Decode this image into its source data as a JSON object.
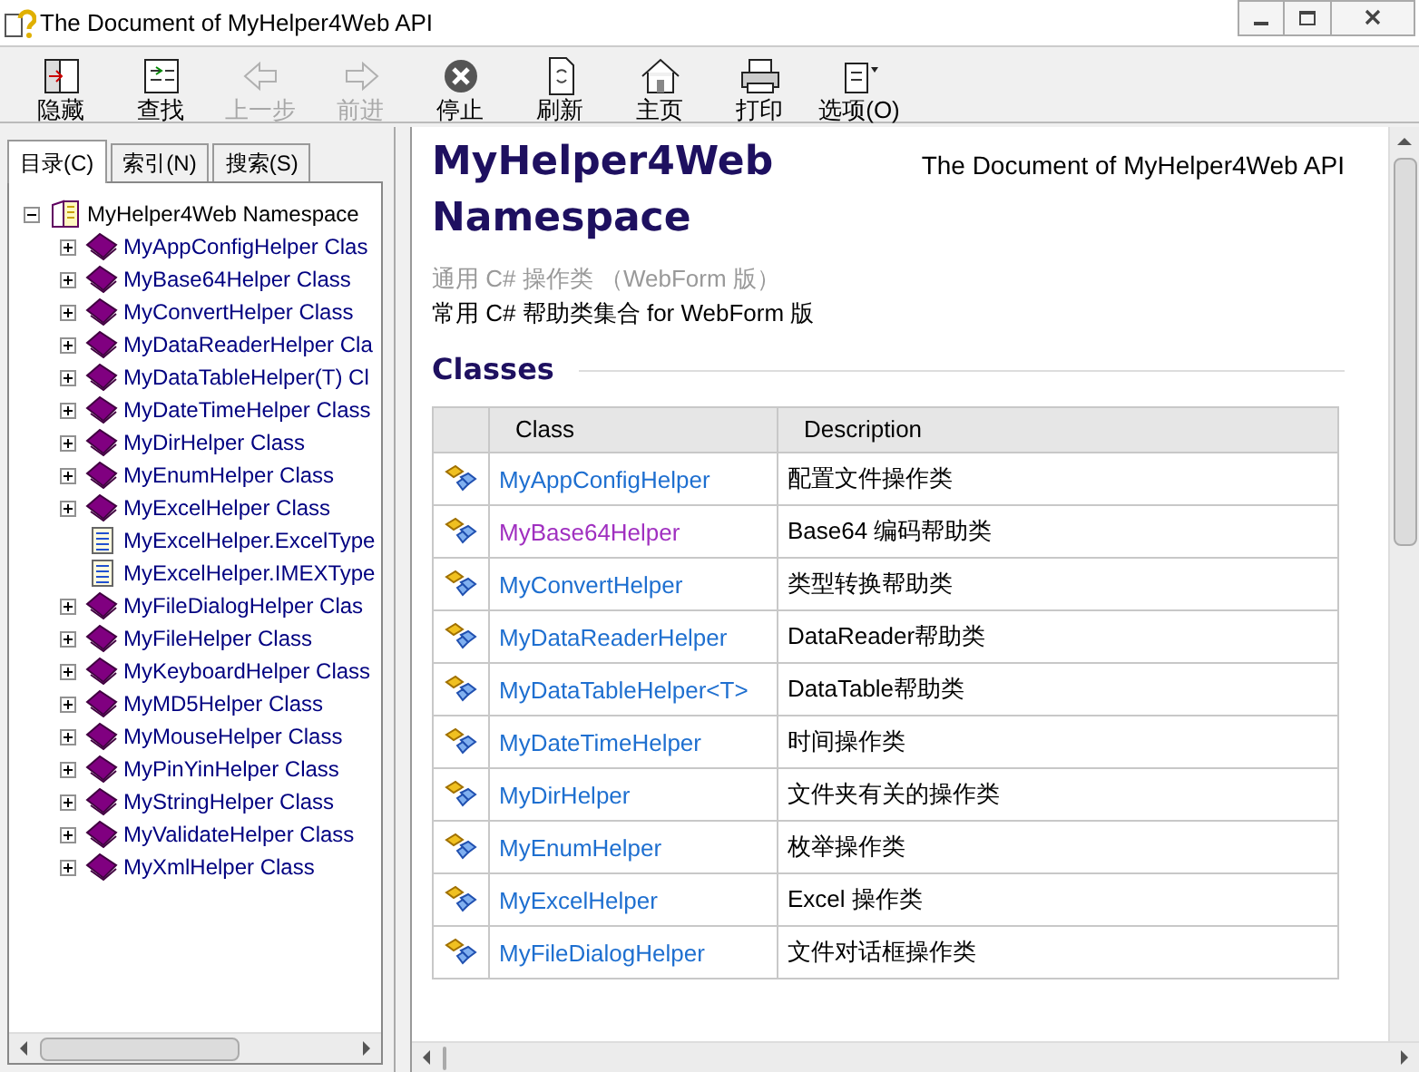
{
  "window": {
    "title": "The Document of MyHelper4Web API"
  },
  "toolbar": [
    {
      "label": "隐藏",
      "kind": "hide",
      "disabled": false
    },
    {
      "label": "查找",
      "kind": "locate",
      "disabled": false
    },
    {
      "label": "上一步",
      "kind": "back",
      "disabled": true
    },
    {
      "label": "前进",
      "kind": "forward",
      "disabled": true
    },
    {
      "label": "停止",
      "kind": "stop",
      "disabled": false
    },
    {
      "label": "刷新",
      "kind": "refresh",
      "disabled": false
    },
    {
      "label": "主页",
      "kind": "home",
      "disabled": false
    },
    {
      "label": "打印",
      "kind": "print",
      "disabled": false
    },
    {
      "label": "选项(O)",
      "kind": "options",
      "disabled": false
    }
  ],
  "tabs": [
    {
      "label": "目录(C)",
      "selected": true
    },
    {
      "label": "索引(N)",
      "selected": false
    },
    {
      "label": "搜索(S)",
      "selected": false
    }
  ],
  "tree": [
    {
      "label": "MyHelper4Web Namespace",
      "kind": "namespace",
      "expanded": true,
      "children": [
        {
          "label": "MyAppConfigHelper Clas",
          "kind": "class",
          "expanded": false
        },
        {
          "label": "MyBase64Helper Class",
          "kind": "class",
          "expanded": false
        },
        {
          "label": "MyConvertHelper Class",
          "kind": "class",
          "expanded": false
        },
        {
          "label": "MyDataReaderHelper Cla",
          "kind": "class",
          "expanded": false
        },
        {
          "label": "MyDataTableHelper(T) Cl",
          "kind": "class",
          "expanded": false
        },
        {
          "label": "MyDateTimeHelper Class",
          "kind": "class",
          "expanded": false
        },
        {
          "label": "MyDirHelper Class",
          "kind": "class",
          "expanded": false
        },
        {
          "label": "MyEnumHelper Class",
          "kind": "class",
          "expanded": false
        },
        {
          "label": "MyExcelHelper Class",
          "kind": "class",
          "expanded": false
        },
        {
          "label": "MyExcelHelper.ExcelType",
          "kind": "page"
        },
        {
          "label": "MyExcelHelper.IMEXType",
          "kind": "page"
        },
        {
          "label": "MyFileDialogHelper Clas",
          "kind": "class",
          "expanded": false
        },
        {
          "label": "MyFileHelper Class",
          "kind": "class",
          "expanded": false
        },
        {
          "label": "MyKeyboardHelper Class",
          "kind": "class",
          "expanded": false
        },
        {
          "label": "MyMD5Helper Class",
          "kind": "class",
          "expanded": false
        },
        {
          "label": "MyMouseHelper Class",
          "kind": "class",
          "expanded": false
        },
        {
          "label": "MyPinYinHelper Class",
          "kind": "class",
          "expanded": false
        },
        {
          "label": "MyStringHelper Class",
          "kind": "class",
          "expanded": false
        },
        {
          "label": "MyValidateHelper Class",
          "kind": "class",
          "expanded": false
        },
        {
          "label": "MyXmlHelper Class",
          "kind": "class",
          "expanded": false
        }
      ]
    }
  ],
  "page": {
    "title": "MyHelper4Web Namespace",
    "header_right": "The Document of MyHelper4Web API",
    "summary_lines": [
      "通用  C# 操作类 （WebForm 版）",
      "常用  C# 帮助类集合  for WebForm 版"
    ],
    "section": "Classes",
    "table": {
      "columns": [
        "Class",
        "Description"
      ],
      "rows": [
        {
          "class": "MyAppConfigHelper",
          "description": "配置文件操作类",
          "visited": false
        },
        {
          "class": "MyBase64Helper",
          "description": "Base64 编码帮助类",
          "visited": true
        },
        {
          "class": "MyConvertHelper",
          "description": "类型转换帮助类",
          "visited": false
        },
        {
          "class": "MyDataReaderHelper",
          "description": "DataReader帮助类",
          "visited": false
        },
        {
          "class": "MyDataTableHelper<T>",
          "description": "DataTable帮助类",
          "visited": false
        },
        {
          "class": "MyDateTimeHelper",
          "description": "时间操作类",
          "visited": false
        },
        {
          "class": "MyDirHelper",
          "description": "文件夹有关的操作类",
          "visited": false
        },
        {
          "class": "MyEnumHelper",
          "description": "枚举操作类",
          "visited": false
        },
        {
          "class": "MyExcelHelper",
          "description": "Excel 操作类",
          "visited": false
        },
        {
          "class": "MyFileDialogHelper",
          "description": "文件对话框操作类",
          "visited": false
        }
      ]
    }
  }
}
